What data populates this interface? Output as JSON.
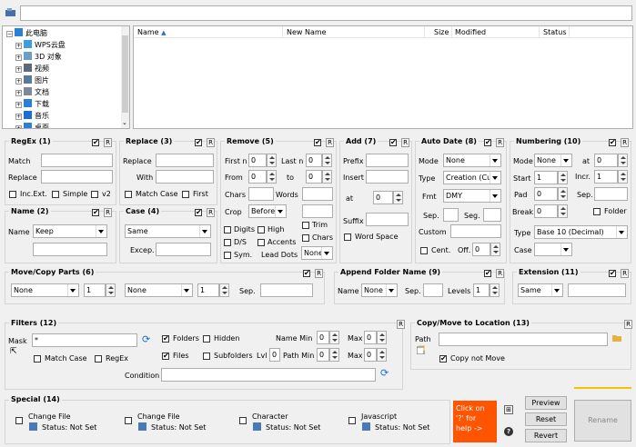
{
  "path_bar": {
    "value": ""
  },
  "tree": {
    "items": [
      {
        "label": "此电脑",
        "color": "#2a7fd8"
      },
      {
        "label": "WPS云盘",
        "color": "#3a9ee0"
      },
      {
        "label": "3D 对象",
        "color": "#6aa0c8"
      },
      {
        "label": "视频",
        "color": "#5a6a7a"
      },
      {
        "label": "图片",
        "color": "#5a7a9a"
      },
      {
        "label": "文档",
        "color": "#7a8a9a"
      },
      {
        "label": "下载",
        "color": "#2a7fd8"
      },
      {
        "label": "音乐",
        "color": "#1a6fd0"
      },
      {
        "label": "桌面",
        "color": "#2a7fd8"
      }
    ]
  },
  "files": {
    "columns": [
      "Name",
      "New Name",
      "Size",
      "Modified",
      "Status"
    ]
  },
  "regex": {
    "title": "RegEx (1)",
    "match": "Match",
    "replace": "Replace",
    "inc_ext": "Inc.Ext.",
    "simple": "Simple",
    "v2": "v2"
  },
  "replace": {
    "title": "Replace (3)",
    "replace": "Replace",
    "with": "With",
    "match_case": "Match Case",
    "first": "First"
  },
  "remove": {
    "title": "Remove (5)",
    "first_n": "First n",
    "last_n": "Last n",
    "from": "From",
    "to": "to",
    "chars": "Chars",
    "words": "Words",
    "crop": "Crop",
    "crop_val": "Before",
    "digits": "Digits",
    "high": "High",
    "trim": "Trim",
    "ds": "D/S",
    "accents": "Accents",
    "chars2": "Chars",
    "sym": "Sym.",
    "lead_dots": "Lead Dots",
    "lead_val": "None",
    "v0": "0"
  },
  "add": {
    "title": "Add (7)",
    "prefix": "Prefix",
    "insert": "Insert",
    "at": "at",
    "at_val": "0",
    "suffix": "Suffix",
    "word_space": "Word Space"
  },
  "autodate": {
    "title": "Auto Date (8)",
    "mode": "Mode",
    "mode_val": "None",
    "type": "Type",
    "type_val": "Creation (Cur",
    "fmt": "Fmt",
    "fmt_val": "DMY",
    "sep": "Sep.",
    "seg": "Seg.",
    "custom": "Custom",
    "cent": "Cent.",
    "off": "Off.",
    "off_val": "0"
  },
  "numbering": {
    "title": "Numbering (10)",
    "mode": "Mode",
    "mode_val": "None",
    "at": "at",
    "at_val": "0",
    "start": "Start",
    "start_val": "1",
    "incr": "Incr.",
    "incr_val": "1",
    "pad": "Pad",
    "pad_val": "0",
    "sep": "Sep.",
    "break": "Break",
    "break_val": "0",
    "folder": "Folder",
    "type": "Type",
    "type_val": "Base 10 (Decimal)",
    "case": "Case"
  },
  "name": {
    "title": "Name (2)",
    "name": "Name",
    "name_val": "Keep"
  },
  "case": {
    "title": "Case (4)",
    "case_val": "Same",
    "excep": "Excep."
  },
  "move": {
    "title": "Move/Copy Parts (6)",
    "none1": "None",
    "n1": "1",
    "none2": "None",
    "n2": "1",
    "sep": "Sep."
  },
  "append": {
    "title": "Append Folder Name (9)",
    "name": "Name",
    "name_val": "None",
    "sep": "Sep.",
    "levels": "Levels",
    "levels_val": "1"
  },
  "extension": {
    "title": "Extension (11)",
    "val": "Same"
  },
  "filters": {
    "title": "Filters (12)",
    "mask": "Mask",
    "mask_val": "*",
    "folders": "Folders",
    "hidden": "Hidden",
    "files": "Files",
    "subfolders": "Subfolders",
    "lvl": "Lvl",
    "lvl_val": "0",
    "match_case": "Match Case",
    "regex": "RegEx",
    "name_min": "Name Min",
    "name_min_val": "0",
    "max": "Max",
    "max_val": "0",
    "path_min": "Path Min",
    "path_min_val": "0",
    "max2_val": "0",
    "condition": "Condition"
  },
  "copymove": {
    "title": "Copy/Move to Location (13)",
    "path": "Path",
    "not_move": "Copy not Move"
  },
  "special": {
    "title": "Special (14)",
    "items": [
      {
        "label": "Change File",
        "status": "Status: Not Set"
      },
      {
        "label": "Change File",
        "status": "Status: Not Set"
      },
      {
        "label": "Character",
        "status": "Status: Not Set"
      },
      {
        "label": "Javascript",
        "status": "Status: Not Set"
      }
    ]
  },
  "help": {
    "text": "Click on '?' for help ->"
  },
  "buttons": {
    "preview": "Preview",
    "reset": "Reset",
    "revert": "Revert",
    "rename": "Rename"
  },
  "colors": {
    "help_bg": "#ff5500",
    "accent": "#f5c400"
  }
}
